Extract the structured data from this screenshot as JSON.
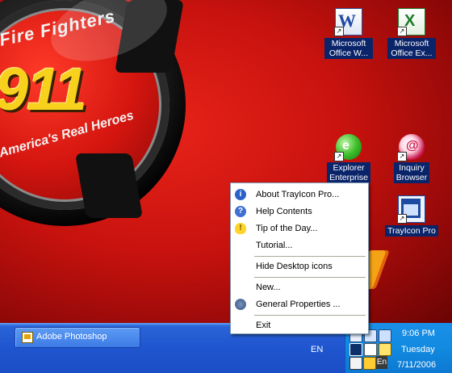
{
  "wallpaper": {
    "line1": "Fire Fighters",
    "number": "911",
    "line2": "America's Real Heroes"
  },
  "desktop_icons": [
    {
      "label": "Microsoft Office W...",
      "icon": "word-icon",
      "glyph": "W"
    },
    {
      "label": "Microsoft Office Ex...",
      "icon": "excel-icon",
      "glyph": "X"
    },
    {
      "label_lines": [
        "Explorer",
        "Enterprise"
      ],
      "icon": "explorer-enterprise-icon",
      "glyph": "e"
    },
    {
      "label_lines": [
        "Inquiry",
        "Browser"
      ],
      "icon": "inquiry-browser-icon",
      "glyph": "@"
    },
    {
      "label": "TrayIcon Pro",
      "icon": "trayicon-pro-icon"
    }
  ],
  "shortcut_arrow": "↗",
  "context_menu": {
    "items": [
      {
        "label": "About TrayIcon Pro...",
        "icon": "info-icon",
        "glyph": "i"
      },
      {
        "label": "Help Contents",
        "icon": "help-icon",
        "glyph": "?"
      },
      {
        "label": "Tip of the Day...",
        "icon": "lightbulb-icon",
        "glyph": "!"
      },
      {
        "label": "Tutorial..."
      },
      {
        "label": "Hide Desktop icons"
      },
      {
        "label": "New..."
      },
      {
        "label": "General Properties ...",
        "icon": "gear-icon"
      },
      {
        "label": "Exit"
      }
    ]
  },
  "taskbar": {
    "task_button": "Adobe Photoshop",
    "language": "EN",
    "tray_lang_badge": "En",
    "clock": {
      "time": "9:06 PM",
      "day": "Tuesday",
      "date": "7/11/2006"
    }
  },
  "colors": {
    "taskbar_blue": "#1f55cf",
    "tray_blue": "#118ae0",
    "selection_blue": "#0a246a",
    "wallpaper_red": "#c8120e",
    "emblem_yellow": "#f7d11c"
  }
}
